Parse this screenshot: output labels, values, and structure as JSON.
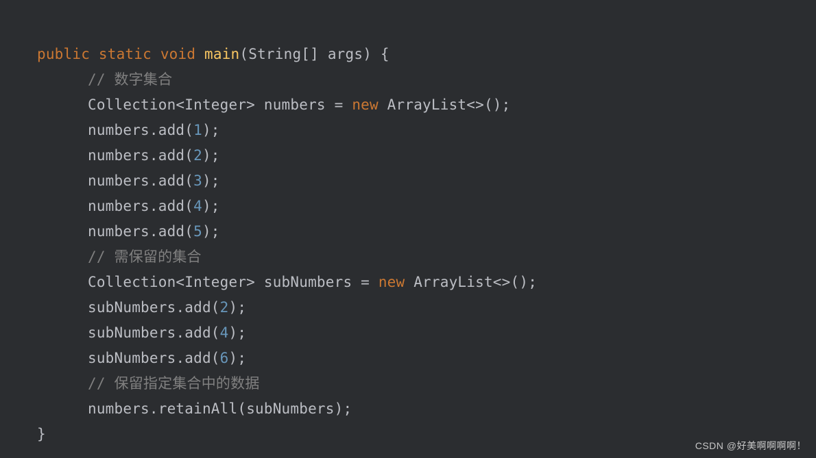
{
  "code": {
    "sig": {
      "kw_public": "public",
      "kw_static": "static",
      "kw_void": "void",
      "fn_main": "main",
      "paren_open": "(",
      "type_string_arr": "String[]",
      "sp": " ",
      "arg_name": "args",
      "paren_close": ")",
      "brace_open": " {"
    },
    "cmt1": "// 数字集合",
    "decl1": {
      "type": "Collection<Integer>",
      "name": "numbers",
      "eq": " = ",
      "kw_new": "new",
      "ctor": " ArrayList<>()",
      "semi": ";"
    },
    "adds1": [
      "1",
      "2",
      "3",
      "4",
      "5"
    ],
    "adds_obj": "numbers",
    "adds_method": ".add(",
    "adds_close": ");",
    "cmt2": "// 需保留的集合",
    "decl2": {
      "type": "Collection<Integer>",
      "name": "subNumbers",
      "eq": " = ",
      "kw_new": "new",
      "ctor": " ArrayList<>()",
      "semi": ";"
    },
    "adds2_obj": "subNumbers",
    "adds2": [
      "2",
      "4",
      "6"
    ],
    "cmt3": "// 保留指定集合中的数据",
    "retain": {
      "obj": "numbers",
      "call": ".retainAll(",
      "arg": "subNumbers",
      "close": ");"
    },
    "brace_close": "}"
  },
  "watermark": "CSDN @好美啊啊啊啊！"
}
